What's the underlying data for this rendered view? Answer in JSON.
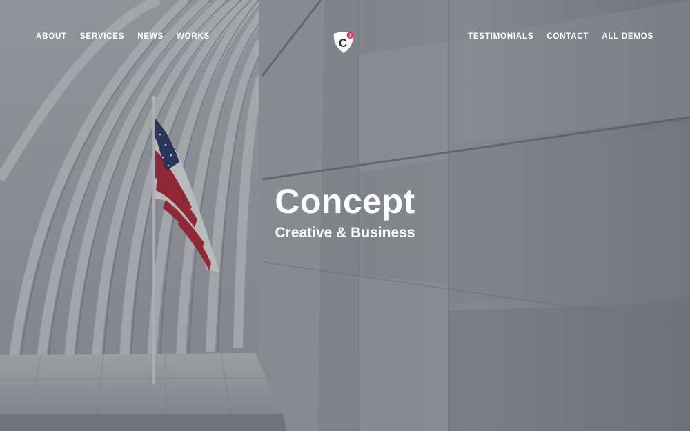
{
  "nav": {
    "left": [
      "ABOUT",
      "SERVICES",
      "NEWS",
      "WORKS"
    ],
    "right": [
      "TESTIMONIALS",
      "CONTACT",
      "ALL DEMOS"
    ]
  },
  "logo": {
    "letter": "C",
    "badge": "1",
    "accent": "#e8365d"
  },
  "hero": {
    "title": "Concept",
    "subtitle": "Creative & Business"
  },
  "colors": {
    "text": "#ffffff",
    "flag_red": "#b8283a",
    "flag_blue": "#2b3a6b"
  }
}
